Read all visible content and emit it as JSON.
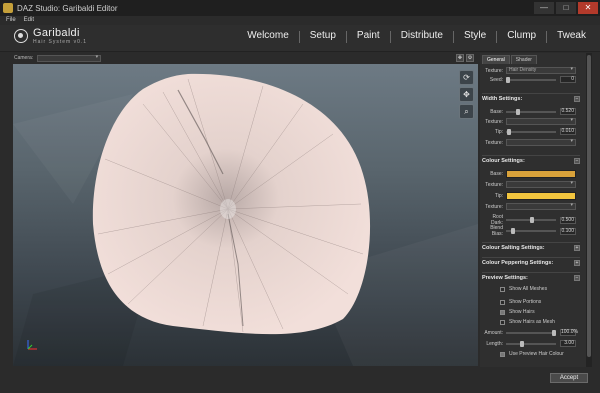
{
  "window": {
    "title": "DAZ Studio: Garibaldi Editor",
    "minimize": "—",
    "maximize": "□",
    "close": "✕"
  },
  "menu": [
    "File",
    "Edit"
  ],
  "logo": {
    "name": "Garibaldi",
    "sub": "Hair System v0.1"
  },
  "nav": [
    "Welcome",
    "Setup",
    "Paint",
    "Distribute",
    "Style",
    "Clump",
    "Tweak"
  ],
  "camera": {
    "label": "Camera:",
    "value": ""
  },
  "viewport_tools": [
    "rotate-icon",
    "pan-icon",
    "zoom-icon"
  ],
  "panel": {
    "tabs": [
      "General",
      "Shader"
    ],
    "texture_label": "Texture:",
    "texture_value": "Hair Density",
    "seed_label": "Seed:",
    "seed_value": "0",
    "width": {
      "title": "Width Settings:",
      "base_label": "Base:",
      "base_value": "0.520",
      "base_pos": 0.2,
      "texture_label": "Texture:",
      "tip_label": "Tip:",
      "tip_value": "0.010",
      "tip_pos": 0.02,
      "texture2_label": "Texture:"
    },
    "colour": {
      "title": "Colour Settings:",
      "base_label": "Base:",
      "base_color": "#d9a23a",
      "texture_label": "Texture:",
      "tip_label": "Tip:",
      "tip_color": "#f2c53e",
      "texture2_label": "Texture:",
      "root_dark_label": "Root Dark:",
      "root_dark_value": "0.500",
      "root_dark_pos": 0.5,
      "blend_bias_label": "Blend Bias:",
      "blend_bias_value": "0.100",
      "blend_bias_pos": 0.1
    },
    "salting_title": "Colour Salting Settings:",
    "peppering_title": "Colour Peppering Settings:",
    "preview": {
      "title": "Preview Settings:",
      "show_all_meshes": "Show All Meshes",
      "show_portions": "Show Portions",
      "show_hairs": "Show Hairs",
      "show_hairs_as_mesh": "Show Hairs as Mesh",
      "amount_label": "Amount:",
      "amount_value": "100.0%",
      "amount_pos": 1.0,
      "length_label": "Length:",
      "length_value": "3.00",
      "length_pos": 0.3,
      "use_preview_colour": "Use Preview Hair Colour"
    }
  },
  "footer": {
    "accept": "Accept"
  }
}
